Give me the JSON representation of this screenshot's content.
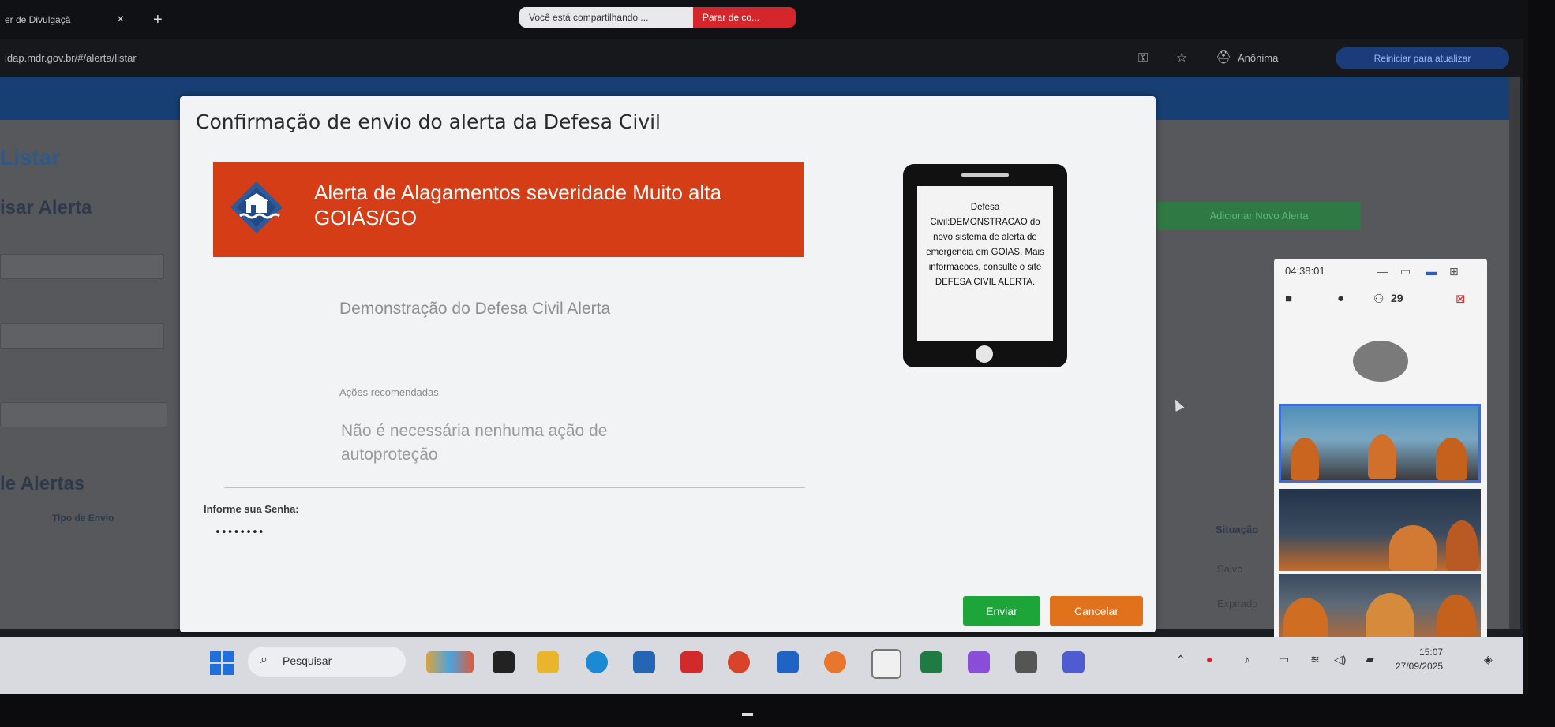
{
  "browser": {
    "tab_title": "er de Divulgaçã",
    "tab_close": "×",
    "new_tab": "+",
    "sharing_message": "Você está compartilhando ...",
    "stop_sharing": "Parar de co...",
    "url": "idap.mdr.gov.br/#/alerta/listar",
    "profile_label": "Anônima",
    "relaunch_label": "Reiniciar para atualizar"
  },
  "background_page": {
    "heading_listar": "Listar",
    "heading_pesquisar": "isar Alerta",
    "heading_alertas": "le Alertas",
    "col_tipo_envio": "Tipo de Envio",
    "col_situacao": "Situação",
    "status_salvo": "Salvo",
    "status_expirado": "Expirado",
    "add_button": "Adicionar Novo Alerta"
  },
  "modal": {
    "title": "Confirmação de envio do alerta da Defesa Civil",
    "alert_title": "Alerta de Alagamentos severidade Muito alta GOIÁS/GO",
    "description": "Demonstração do Defesa Civil Alerta",
    "actions_label": "Ações recomendadas",
    "actions_text": "Não é necessária nenhuma ação de autoproteção",
    "password_label": "Informe sua Senha:",
    "password_value": "••••••••",
    "send_button": "Enviar",
    "cancel_button": "Cancelar",
    "phone_message": "Defesa Civil:DEMONSTRACAO do novo sistema de alerta de emergencia em GOIAS. Mais informacoes, consulte o site DEFESA CIVIL ALERTA."
  },
  "meeting": {
    "time": "04:38:01",
    "participants": "29"
  },
  "taskbar": {
    "search_label": "Pesquisar",
    "time": "15:07",
    "date": "27/09/2025"
  },
  "colors": {
    "alert_banner": "#d53d16",
    "send_button": "#1ea53a",
    "cancel_button": "#e2711c"
  }
}
